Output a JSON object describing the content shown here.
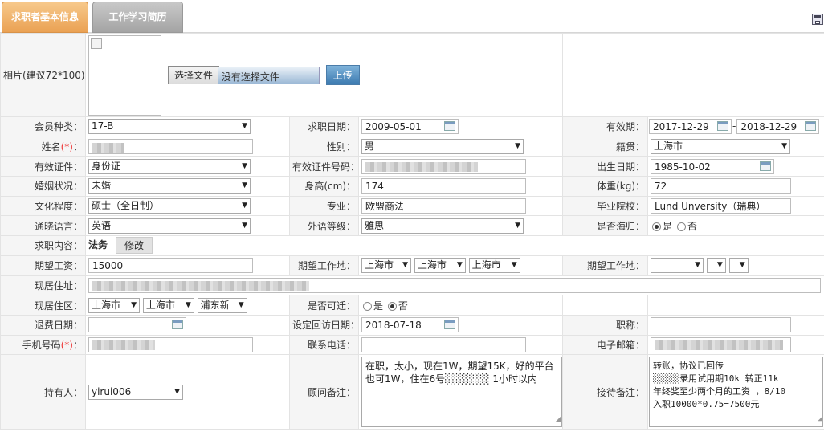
{
  "tabs": [
    {
      "label": "求职者基本信息"
    },
    {
      "label": "工作学习简历"
    }
  ],
  "photo": {
    "label": "相片(建议72*100)：",
    "file_button": "选择文件",
    "file_status": "没有选择文件",
    "upload_button": "上传"
  },
  "fields": {
    "member_type": {
      "label": "会员种类：",
      "value": "17-B"
    },
    "apply_date": {
      "label": "求职日期：",
      "value": "2009-05-01"
    },
    "valid_period": {
      "label": "有效期：",
      "from": "2017-12-29",
      "sep": "-",
      "to": "2018-12-29"
    },
    "name": {
      "label": "姓名",
      "req": "(*)",
      "colon": "："
    },
    "gender": {
      "label": "性别：",
      "value": "男"
    },
    "native": {
      "label": "籍贯：",
      "value": "上海市"
    },
    "id_type": {
      "label": "有效证件：",
      "value": "身份证"
    },
    "id_number": {
      "label": "有效证件号码："
    },
    "birth": {
      "label": "出生日期：",
      "value": "1985-10-02"
    },
    "marital": {
      "label": "婚姻状况：",
      "value": "未婚"
    },
    "height": {
      "label": "身高(cm)：",
      "value": "174"
    },
    "weight": {
      "label": "体重(kg)：",
      "value": "72"
    },
    "education": {
      "label": "文化程度：",
      "value": "硕士（全日制）"
    },
    "major": {
      "label": "专业：",
      "value": "欧盟商法"
    },
    "school": {
      "label": "毕业院校：",
      "value": "Lund Unversity（瑞典）"
    },
    "language": {
      "label": "通晓语言：",
      "value": "英语"
    },
    "lang_level": {
      "label": "外语等级：",
      "value": "雅思"
    },
    "returnee": {
      "label": "是否海归：",
      "yes": "是",
      "no": "否",
      "selected": "yes"
    },
    "job_content": {
      "label": "求职内容：",
      "value": "法务",
      "button": "修改"
    },
    "salary": {
      "label": "期望工资：",
      "value": "15000"
    },
    "work_place1": {
      "label": "期望工作地：",
      "province": "上海市",
      "city": "上海市",
      "district": "上海市"
    },
    "work_place2": {
      "label": "期望工作地：",
      "province": "",
      "city": "",
      "district": ""
    },
    "address": {
      "label": "现居住址："
    },
    "district": {
      "label": "现居住区：",
      "province": "上海市",
      "city": "上海市",
      "area": "浦东新"
    },
    "relocate": {
      "label": "是否可迁：",
      "yes": "是",
      "no": "否",
      "selected": "no"
    },
    "refund_date": {
      "label": "退费日期：",
      "value": ""
    },
    "callback_date": {
      "label": "设定回访日期：",
      "value": "2018-07-18"
    },
    "title": {
      "label": "职称：",
      "value": ""
    },
    "mobile": {
      "label": "手机号码",
      "req": "(*)",
      "colon": "："
    },
    "phone": {
      "label": "联系电话：",
      "value": ""
    },
    "email": {
      "label": "电子邮箱："
    },
    "owner": {
      "label": "持有人：",
      "value": "yirui006"
    },
    "advisor_note": {
      "label": "顾问备注：",
      "value": "在职，太小，现在1W，期望15K，好的平台也可1W，住在6号░░░░░░ 1小时以内"
    },
    "reception_note": {
      "label": "接待备注：",
      "value": "转账，协议已回传\n░░░░░录用试用期10k 转正11k\n年终奖至少两个月的工资 ，8/10\n入职10000*0.75=7500元"
    }
  },
  "icons": [
    "save-icon",
    "calendar-icon",
    "chevron-down-icon"
  ],
  "colors": {
    "tab_active": "#eaa153",
    "tab_inactive": "#a4a4a4",
    "label_bg": "#f5f5f5",
    "upload_button": "#3c7ab0"
  }
}
